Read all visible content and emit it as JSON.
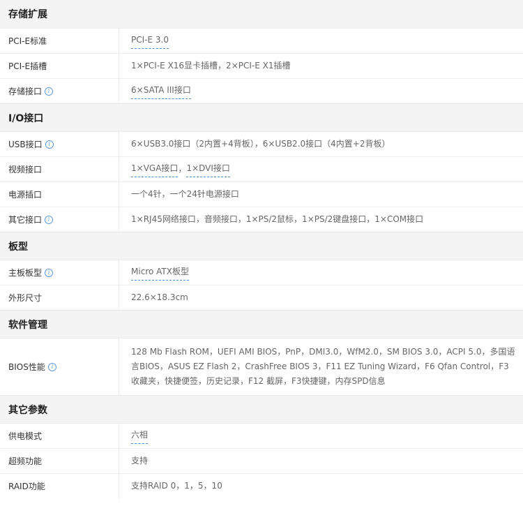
{
  "sections": {
    "storage": {
      "title": "存储扩展",
      "pcie_standard": {
        "label": "PCI-E标准",
        "value": "PCI-E 3.0"
      },
      "pcie_slots": {
        "label": "PCI-E插槽",
        "value": "1×PCI-E X16显卡插槽，2×PCI-E X1插槽"
      },
      "storage_ports": {
        "label": "存储接口",
        "value": "6×SATA III接口"
      }
    },
    "io": {
      "title": "I/O接口",
      "usb": {
        "label": "USB接口",
        "value": "6×USB3.0接口（2内置+4背板），6×USB2.0接口（4内置+2背板）"
      },
      "video": {
        "label": "视频接口",
        "value_1": "1×VGA接口",
        "sep": "，",
        "value_2": "1×DVI接口"
      },
      "power": {
        "label": "电源插口",
        "value": "一个4针，一个24针电源接口"
      },
      "other": {
        "label": "其它接口",
        "value": "1×RJ45网络接口，音频接口，1×PS/2鼠标，1×PS/2键盘接口，1×COM接口"
      }
    },
    "board": {
      "title": "板型",
      "form_factor": {
        "label": "主板板型",
        "value": "Micro ATX板型"
      },
      "dimensions": {
        "label": "外形尺寸",
        "value": "22.6×18.3cm"
      }
    },
    "software": {
      "title": "软件管理",
      "bios": {
        "label": "BIOS性能",
        "value": "128 Mb Flash ROM，UEFI AMI BIOS，PnP，DMI3.0，WfM2.0，SM BIOS 3.0，ACPI 5.0，多国语言BIOS，ASUS EZ Flash 2，CrashFree BIOS 3，F11 EZ Tuning Wizard，F6 Qfan Control，F3 收藏夹，快捷便签，历史记录，F12 截屏，F3快捷键，内存SPD信息"
      }
    },
    "other": {
      "title": "其它参数",
      "power_phase": {
        "label": "供电模式",
        "value": "六相"
      },
      "overclock": {
        "label": "超频功能",
        "value": "支持"
      },
      "raid": {
        "label": "RAID功能",
        "value": "支持RAID 0，1，5，10"
      }
    }
  },
  "icons": {
    "info": "info-icon",
    "info_glyph": "i"
  },
  "colors": {
    "link_underline": "#4a90d9",
    "info_icon": "#5b9be6",
    "header_bg": "#f4f4f4"
  }
}
